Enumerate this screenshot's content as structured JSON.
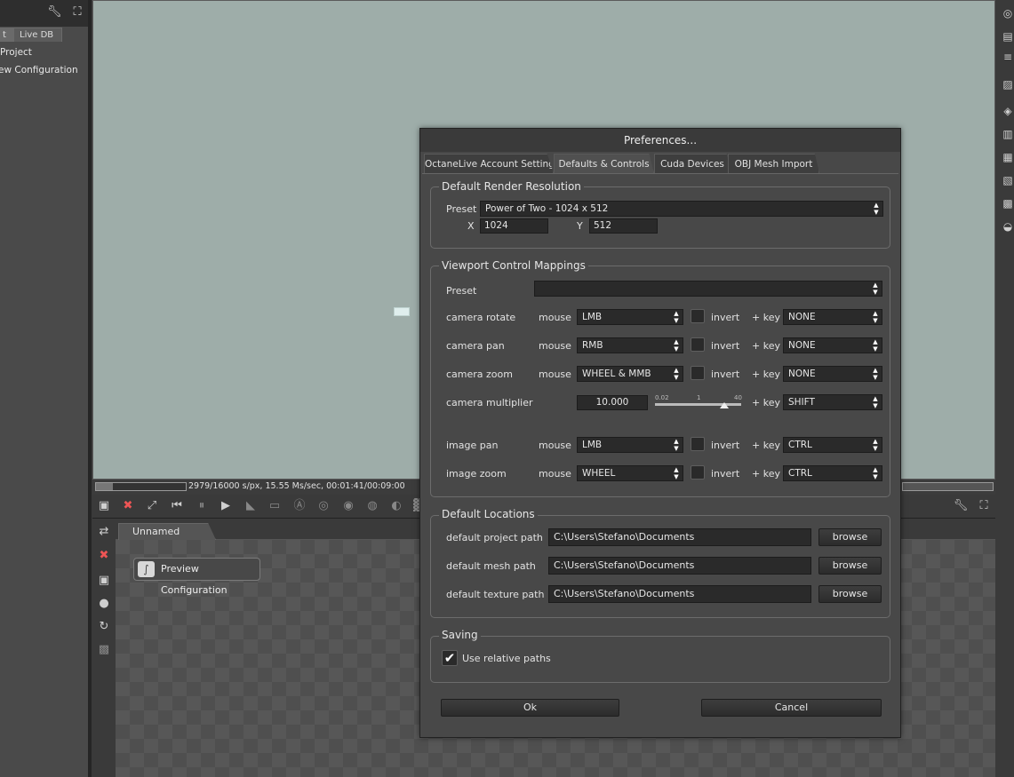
{
  "left_panel": {
    "tabs": [
      "t",
      "Live DB"
    ],
    "items": [
      "Project",
      "ew Configuration"
    ]
  },
  "viewport": {
    "progress": 0.1861,
    "status": "2979/16000 s/px, 15.55 Ms/sec, 00:01:41/00:09:00"
  },
  "graph_editor": {
    "tab": "Unnamed Project",
    "node_label": "Preview Configuration"
  },
  "dialog": {
    "title": "Preferences...",
    "tabs": [
      "OctaneLive Account Settings",
      "Defaults & Controls",
      "Cuda Devices",
      "OBJ Mesh Import"
    ],
    "active_tab": "Defaults & Controls",
    "render_res": {
      "title": "Default Render Resolution",
      "preset_label": "Preset",
      "preset_value": "Power of Two - 1024 x 512",
      "x_label": "X",
      "x_value": "1024",
      "y_label": "Y",
      "y_value": "512"
    },
    "viewport_ctrl": {
      "title": "Viewport Control Mappings",
      "preset_label": "Preset",
      "preset_value": "",
      "mouse_label": "mouse",
      "invert_label": "invert",
      "key_label": "+ key",
      "rows": [
        {
          "label": "camera rotate",
          "mouse": "LMB",
          "key": "NONE",
          "invert": false
        },
        {
          "label": "camera pan",
          "mouse": "RMB",
          "key": "NONE",
          "invert": false
        },
        {
          "label": "camera zoom",
          "mouse": "WHEEL & MMB",
          "key": "NONE",
          "invert": false
        },
        {
          "label": "image pan",
          "mouse": "LMB",
          "key": "CTRL",
          "invert": false
        },
        {
          "label": "image zoom",
          "mouse": "WHEEL",
          "key": "CTRL",
          "invert": false
        }
      ],
      "multiplier": {
        "label": "camera multiplier",
        "value": "10.000",
        "slider_min": "0.02",
        "slider_mid": "1",
        "slider_max": "40",
        "slider_fraction": 0.8,
        "key": "SHIFT"
      }
    },
    "locations": {
      "title": "Default Locations",
      "browse_label": "browse",
      "rows": [
        {
          "label": "default project path",
          "value": "C:\\Users\\Stefano\\Documents"
        },
        {
          "label": "default mesh path",
          "value": "C:\\Users\\Stefano\\Documents"
        },
        {
          "label": "default texture path",
          "value": "C:\\Users\\Stefano\\Documents"
        }
      ]
    },
    "saving": {
      "title": "Saving",
      "relative_label": "Use relative paths",
      "relative_checked": true
    },
    "ok_label": "Ok",
    "cancel_label": "Cancel"
  }
}
